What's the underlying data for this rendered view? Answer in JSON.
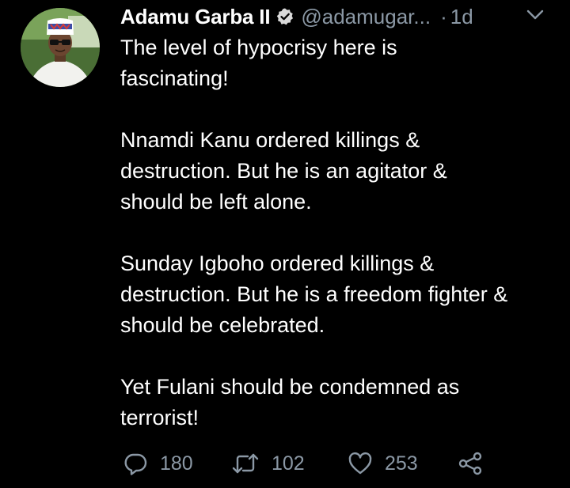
{
  "tweet": {
    "author": {
      "display_name": "Adamu Garba II",
      "handle": "@adamugar...",
      "verified": true,
      "avatar_icon": "profile-photo"
    },
    "separator": "·",
    "time": "1d",
    "menu_icon": "chevron-down-icon",
    "text_lines": [
      "The level of hypocrisy here is",
      "fascinating!",
      "",
      "Nnamdi Kanu ordered killings &",
      "destruction. But he is an agitator &",
      "should be left alone.",
      "",
      "Sunday Igboho ordered killings &",
      "destruction. But he is a freedom fighter &",
      "should be celebrated.",
      "",
      "Yet Fulani should be condemned as",
      "terrorist!"
    ],
    "actions": {
      "reply_count": "180",
      "retweet_count": "102",
      "like_count": "253"
    }
  },
  "colors": {
    "background": "#000000",
    "text": "#ffffff",
    "muted": "#8b98a5",
    "verified_badge": "#d9d9d9"
  }
}
